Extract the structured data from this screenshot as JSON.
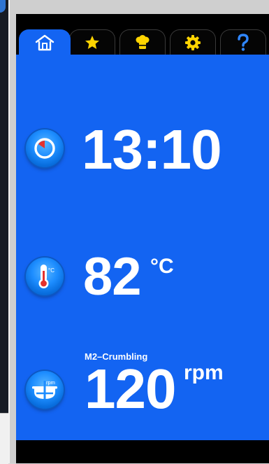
{
  "tabs": [
    {
      "icon": "home-icon",
      "active": true
    },
    {
      "icon": "star-icon",
      "active": false
    },
    {
      "icon": "chef-hat-icon",
      "active": false
    },
    {
      "icon": "gear-icon",
      "active": false
    },
    {
      "icon": "help-icon",
      "active": false
    }
  ],
  "time": {
    "value": "13:10",
    "icon": "timer-icon"
  },
  "temperature": {
    "value": "82",
    "unit": "°C",
    "icon": "thermometer-icon"
  },
  "speed": {
    "value": "120",
    "unit": "rpm",
    "program": "M2–Crumbling",
    "icon": "speed-rpm-icon"
  },
  "colors": {
    "panel": "#1364f2",
    "frame": "#000000",
    "accent": "#ffd400",
    "text": "#ffffff"
  }
}
